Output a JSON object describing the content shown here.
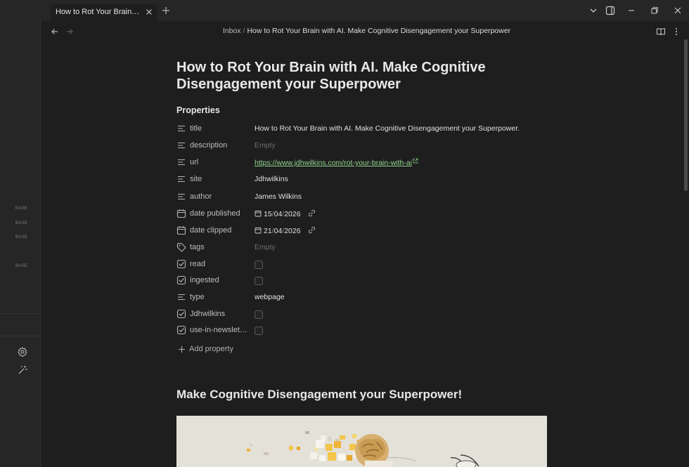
{
  "window": {
    "tab_title": "How to Rot Your Brain with AI. Make Cognitive Disengagement your Superpower"
  },
  "sidebar": {
    "base_labels": [
      "BASE",
      "BASE",
      "BASE",
      "BASE"
    ]
  },
  "breadcrumb": {
    "folder": "Inbox",
    "separator": "/",
    "current": "How to Rot Your Brain with AI. Make Cognitive Disengagement your Superpower"
  },
  "note": {
    "title": "How to Rot Your Brain with AI. Make Cognitive Disengagement your Superpower",
    "properties_heading": "Properties",
    "properties": [
      {
        "key": "title",
        "icon": "text-lines-icon",
        "value": "How to Rot Your Brain with AI. Make Cognitive Disengagement your Superpower."
      },
      {
        "key": "description",
        "icon": "text-lines-icon",
        "value": "Empty"
      },
      {
        "key": "url",
        "icon": "text-lines-icon",
        "value": "https://www.jdhwilkins.com/rot-your-brain-with-ai"
      },
      {
        "key": "site",
        "icon": "text-lines-icon",
        "value": "Jdhwilkins"
      },
      {
        "key": "author",
        "icon": "text-lines-icon",
        "value": "James Wilkins"
      },
      {
        "key": "date published",
        "icon": "calendar-icon",
        "day": "15",
        "month": "04",
        "year": "2026"
      },
      {
        "key": "date clipped",
        "icon": "calendar-icon",
        "day": "21",
        "month": "04",
        "year": "2026"
      },
      {
        "key": "tags",
        "icon": "tag-icon",
        "value": "Empty"
      },
      {
        "key": "read",
        "icon": "checkbox-icon",
        "checked": false
      },
      {
        "key": "ingested",
        "icon": "checkbox-icon",
        "checked": false
      },
      {
        "key": "type",
        "icon": "text-lines-icon",
        "value": "webpage"
      },
      {
        "key": "Jdhwilkins",
        "icon": "checkbox-icon",
        "checked": false
      },
      {
        "key": "use-in-newsletter",
        "icon": "checkbox-icon",
        "checked": false
      }
    ],
    "add_property_label": "Add property",
    "section_heading": "Make Cognitive Disengagement your Superpower!"
  },
  "colors": {
    "background": "#1e1e1e",
    "chrome": "#262626",
    "link": "#8fd48d"
  }
}
